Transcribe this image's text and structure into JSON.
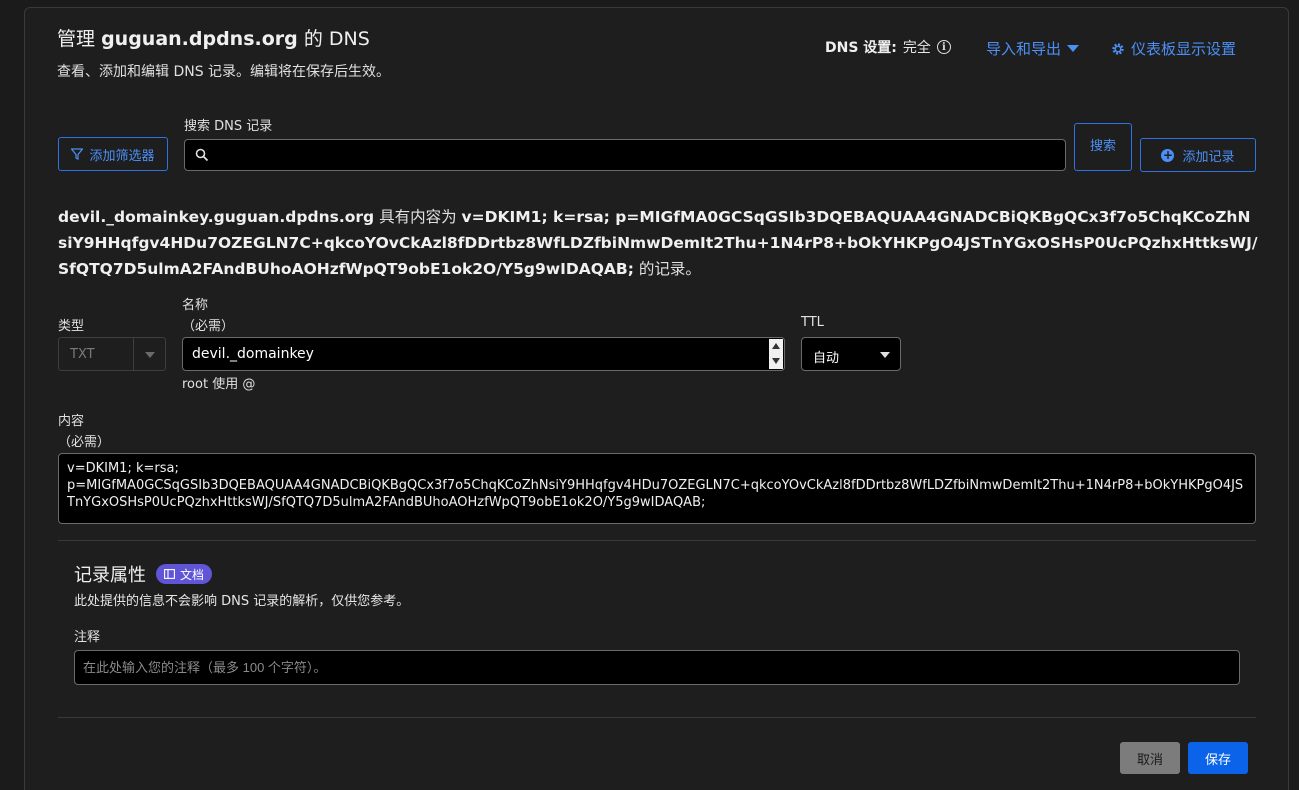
{
  "header": {
    "title_prefix": "管理",
    "title_domain": "guguan.dpdns.org",
    "title_suffix": "的 DNS",
    "subtitle": "查看、添加和编辑 DNS 记录。编辑将在保存后生效。",
    "dns_setting_label": "DNS 设置:",
    "dns_setting_value": "完全",
    "import_export_label": "导入和导出",
    "dashboard_settings_label": "仪表板显示设置"
  },
  "toolbar": {
    "filter_label": "添加筛选器",
    "search_label": "搜索 DNS 记录",
    "search_value": "",
    "search_button_label": "搜索",
    "add_record_label": "添加记录"
  },
  "record": {
    "name": "devil._domainkey.guguan.dpdns.org",
    "mid_text": "具有内容为",
    "content": "v=DKIM1; k=rsa; p=MIGfMA0GCSqGSIb3DQEBAQUAA4GNADCBiQKBgQCx3f7o5ChqKCoZhNsiY9HHqfgv4HDu7OZEGLN7C+qkcoYOvCkAzl8fDDrtbz8WfLDZfbiNmwDemIt2Thu+1N4rP8+bOkYHKPgO4JSTnYGxOSHsP0UcPQzhxHttksWJ/SfQTQ7D5ulmA2FAndBUhoAOHzfWpQT9obE1ok2O/Y5g9wIDAQAB;",
    "end_text": "的记录。"
  },
  "form": {
    "type_label": "类型",
    "type_value": "TXT",
    "name_label": "名称",
    "name_required": "（必需）",
    "name_value": "devil._domainkey",
    "name_hint": "root 使用 @",
    "ttl_label": "TTL",
    "ttl_value": "自动",
    "content_label": "内容",
    "content_required": "（必需）",
    "content_line1": "v=DKIM1; k=rsa;",
    "content_line2": "p=MIGfMA0GCSqGSIb3DQEBAQUAA4GNADCBiQKBgQCx3f7o5ChqKCoZhNsiY9HHqfgv4HDu7OZEGLN7C+qkcoYOvCkAzl8fDDrtbz8WfLDZfbiNmwDemIt2Thu+1N4rP8+bOkYHKPgO4JSTnYGxOSHsP0UcPQzhxHttksWJ/SfQTQ7D5ulmA2FAndBUhoAOHzfWpQT9obE1ok2O/Y5g9wIDAQAB;"
  },
  "attributes": {
    "title": "记录属性",
    "doc_badge": "文档",
    "subtitle": "此处提供的信息不会影响 DNS 记录的解析，仅供您参考。",
    "comment_label": "注释",
    "comment_placeholder": "在此处输入您的注释（最多 100 个字符）。"
  },
  "actions": {
    "cancel_label": "取消",
    "save_label": "保存"
  },
  "colors": {
    "accent": "#4c8ff5",
    "primary_button": "#0a63e8",
    "badge": "#5f55d6"
  }
}
